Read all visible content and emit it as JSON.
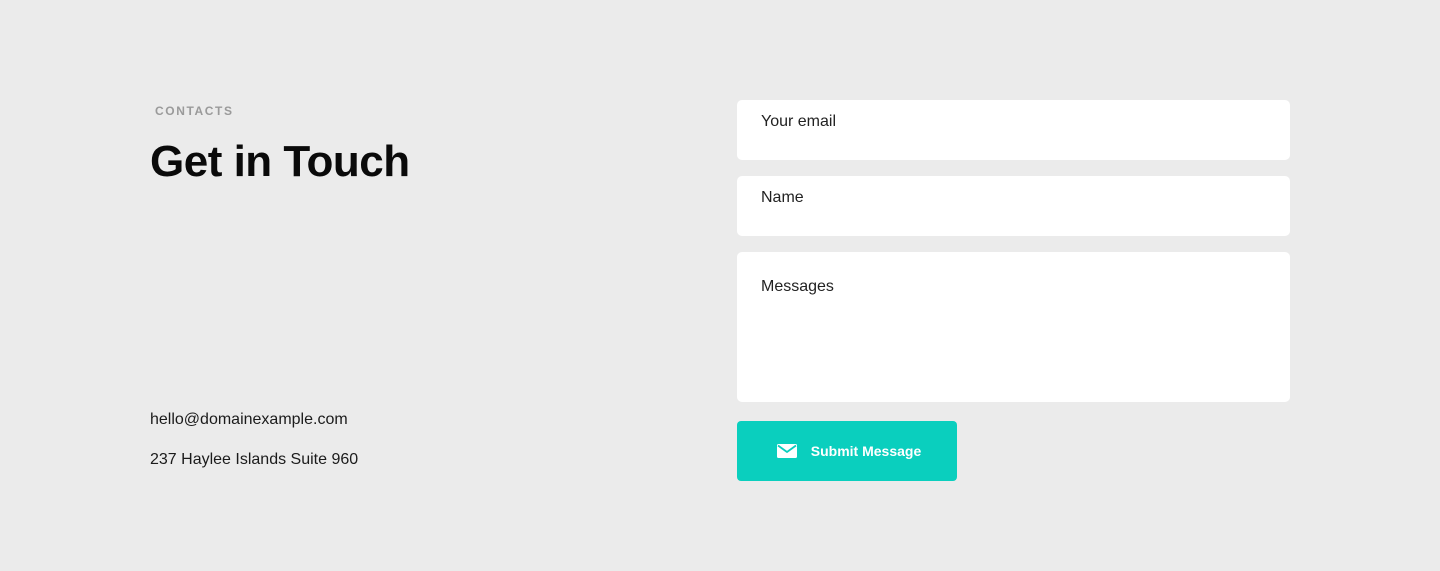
{
  "header": {
    "eyebrow": "CONTACTS",
    "title": "Get in Touch"
  },
  "contact": {
    "email": "hello@domainexample.com",
    "address": "237 Haylee Islands Suite 960"
  },
  "form": {
    "email_placeholder": "Your email",
    "name_placeholder": "Name",
    "message_placeholder": "Messages",
    "submit_label": "Submit Message",
    "submit_icon": "mail-icon"
  },
  "colors": {
    "background": "#ebebeb",
    "accent": "#0acfbe",
    "field_background": "#ffffff"
  }
}
